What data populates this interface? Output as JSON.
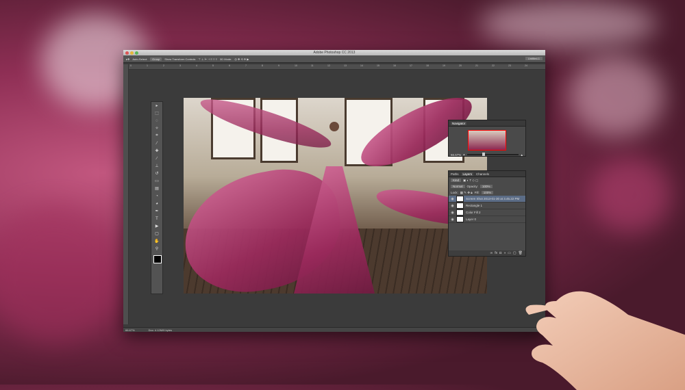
{
  "window": {
    "title": "Adobe Photoshop CC 2013"
  },
  "options_bar": {
    "auto_select_label": "Auto-Select:",
    "auto_select_value": "Group",
    "transform_label": "Show Transform Controls",
    "mode_label": "3D Mode:",
    "workspace_value": "Untitled-1"
  },
  "ruler": {
    "ticks": [
      "0",
      "1",
      "2",
      "3",
      "4",
      "5",
      "6",
      "7",
      "8",
      "9",
      "10",
      "11",
      "12",
      "13",
      "14",
      "15",
      "16",
      "17",
      "18",
      "19",
      "20",
      "21",
      "22",
      "23",
      "24"
    ]
  },
  "tools": [
    "move",
    "marquee",
    "lasso",
    "quick-select",
    "crop",
    "eyedropper",
    "healing",
    "brush",
    "stamp",
    "history",
    "eraser",
    "gradient",
    "blur",
    "dodge",
    "pen",
    "type",
    "path-select",
    "shape",
    "hand",
    "zoom"
  ],
  "navigator": {
    "tab": "Navigator",
    "zoom": "66.67%"
  },
  "layers_panel": {
    "tabs": [
      "Paths",
      "Layers",
      "Channels"
    ],
    "kind_label": "Kind",
    "blend_mode": "Normal",
    "opacity_label": "Opacity:",
    "opacity_value": "100%",
    "lock_label": "Lock:",
    "fill_label": "Fill:",
    "fill_value": "100%",
    "layers": [
      {
        "name": "Screen Shot 2013-01-30 at 3.45.22 PM",
        "selected": true
      },
      {
        "name": "Rectangle 1",
        "selected": false
      },
      {
        "name": "Color Fill 2",
        "selected": false
      },
      {
        "name": "Layer 0",
        "selected": false
      }
    ]
  },
  "status": {
    "zoom": "66.67%",
    "doc": "Doc: 4.12M/9 bytes"
  },
  "colors": {
    "accent": "#5b6c86",
    "fabric": "#9b2a5c",
    "panel": "#4a4a4a"
  }
}
